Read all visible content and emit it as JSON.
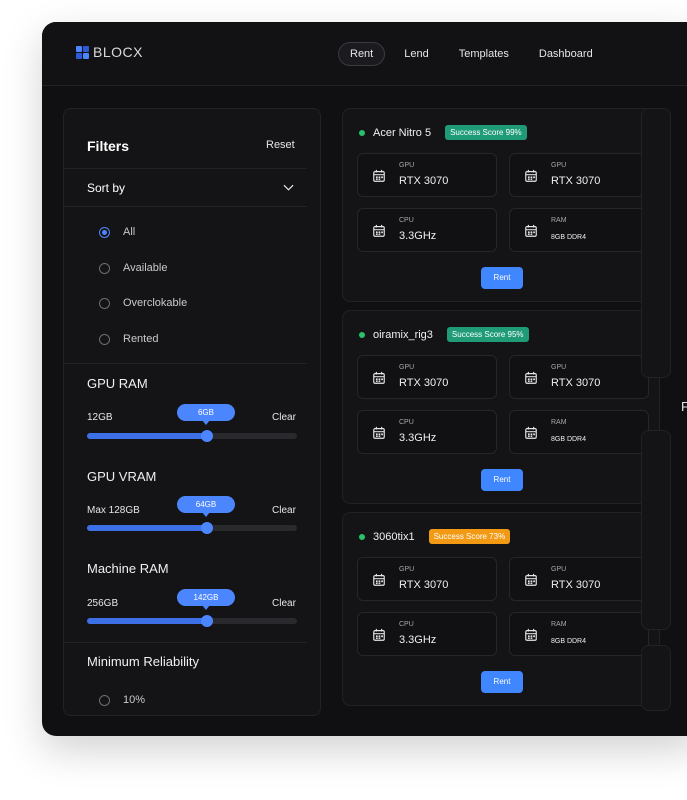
{
  "brand": {
    "name": "BLOCX"
  },
  "nav": [
    {
      "label": "Rent",
      "active": true
    },
    {
      "label": "Lend",
      "active": false
    },
    {
      "label": "Templates",
      "active": false
    },
    {
      "label": "Dashboard",
      "active": false
    }
  ],
  "filters": {
    "title": "Filters",
    "reset": "Reset",
    "sort_by": "Sort by",
    "options": [
      {
        "label": "All",
        "checked": true
      },
      {
        "label": "Available",
        "checked": false
      },
      {
        "label": "Overclokable",
        "checked": false
      },
      {
        "label": "Rented",
        "checked": false
      }
    ],
    "sliders": [
      {
        "title": "GPU RAM",
        "range_label": "12GB",
        "value_label": "6GB",
        "clear": "Clear",
        "fraction": 0.57
      },
      {
        "title": "GPU VRAM",
        "range_label": "Max 128GB",
        "value_label": "64GB",
        "clear": "Clear",
        "fraction": 0.57
      },
      {
        "title": "Machine RAM",
        "range_label": "256GB",
        "value_label": "142GB",
        "clear": "Clear",
        "fraction": 0.57
      }
    ],
    "reliability": {
      "title": "Minimum Reliability",
      "option": "10%"
    }
  },
  "machines": [
    {
      "name": "Acer Nitro 5",
      "score": "Success Score 99%",
      "score_color": "#1f9b78",
      "specs": [
        {
          "label": "GPU",
          "value": "RTX 3070"
        },
        {
          "label": "GPU",
          "value": "RTX 3070"
        },
        {
          "label": "CPU",
          "value": "3.3GHz"
        },
        {
          "label": "RAM",
          "value": "8GB DDR4"
        }
      ],
      "action": "Rent"
    },
    {
      "name": "oiramix_rig3",
      "score": "Success Score 95%",
      "score_color": "#1f9b78",
      "specs": [
        {
          "label": "GPU",
          "value": "RTX 3070"
        },
        {
          "label": "GPU",
          "value": "RTX 3070"
        },
        {
          "label": "CPU",
          "value": "3.3GHz"
        },
        {
          "label": "RAM",
          "value": "8GB DDR4"
        }
      ],
      "action": "Rent"
    },
    {
      "name": "3060tix1",
      "score": "Success Score 73%",
      "score_color": "#f29a14",
      "specs": [
        {
          "label": "GPU",
          "value": "RTX 3070"
        },
        {
          "label": "GPU",
          "value": "RTX 3070"
        },
        {
          "label": "CPU",
          "value": "3.3GHz"
        },
        {
          "label": "RAM",
          "value": "8GB DDR4"
        }
      ],
      "action": "Rent"
    }
  ],
  "side": {
    "letter": "F"
  },
  "colors": {
    "accent": "#4c86ff",
    "online": "#27c26b",
    "background": "#101012"
  }
}
